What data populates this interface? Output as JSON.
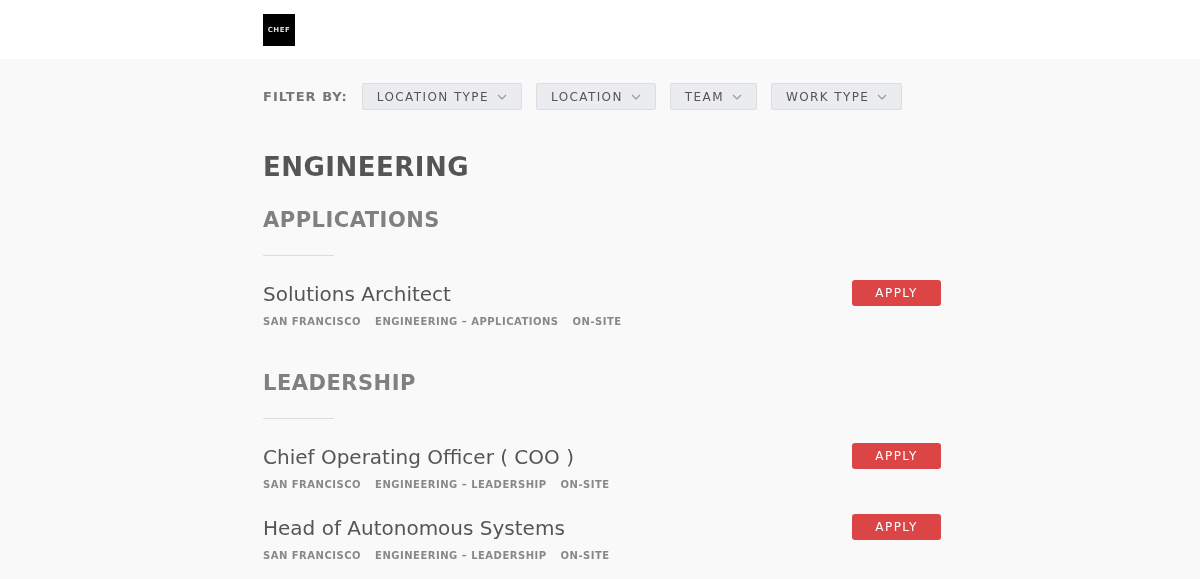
{
  "logo": "CHEF",
  "filter": {
    "label": "FILTER BY:",
    "dropdowns": [
      "LOCATION TYPE",
      "LOCATION",
      "TEAM",
      "WORK TYPE"
    ]
  },
  "department": "ENGINEERING",
  "teams": [
    {
      "name": "APPLICATIONS",
      "jobs": [
        {
          "title": "Solutions Architect",
          "tags": [
            "SAN FRANCISCO",
            "ENGINEERING – APPLICATIONS",
            "ON-SITE"
          ],
          "button": "APPLY"
        }
      ]
    },
    {
      "name": "LEADERSHIP",
      "jobs": [
        {
          "title": "Chief Operating Officer ( COO )",
          "tags": [
            "SAN FRANCISCO",
            "ENGINEERING – LEADERSHIP",
            "ON-SITE"
          ],
          "button": "APPLY"
        },
        {
          "title": "Head of Autonomous Systems",
          "tags": [
            "SAN FRANCISCO",
            "ENGINEERING – LEADERSHIP",
            "ON-SITE"
          ],
          "button": "APPLY"
        }
      ]
    }
  ]
}
